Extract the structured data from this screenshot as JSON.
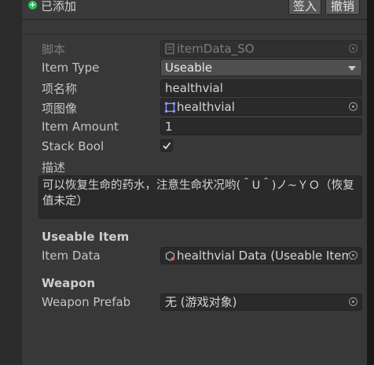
{
  "header": {
    "added_label": "已添加",
    "checkin_button": "签入",
    "revert_button": "撤销"
  },
  "fields": {
    "script_label": "脚本",
    "script_value": "itemData_SO",
    "item_type_label": "Item Type",
    "item_type_value": "Useable",
    "name_label": "项名称",
    "name_value": "healthvial",
    "image_label": "项图像",
    "image_value": "healthvial",
    "amount_label": "Item Amount",
    "amount_value": "1",
    "stack_label": "Stack Bool",
    "stack_checked": true,
    "description_label": "描述",
    "description_value": "可以恢复生命的药水，注意生命状况哟(＾U＾)ノ~ＹＯ（恢复值未定）"
  },
  "useable_item": {
    "title": "Useable Item",
    "item_data_label": "Item Data",
    "item_data_value": "healthvial Data (Useable Item"
  },
  "weapon": {
    "title": "Weapon",
    "prefab_label": "Weapon Prefab",
    "prefab_value": "无 (游戏对象)"
  },
  "icons": {
    "added": "plus-circle-icon",
    "script": "script-file-icon",
    "sprite": "sprite-icon",
    "scriptable_object": "scriptable-object-icon",
    "object_picker": "object-picker-icon",
    "dropdown": "chevron-down-icon",
    "check": "checkmark-icon"
  },
  "colors": {
    "background": "#383838",
    "field_bg": "#2a2a2a",
    "added_green": "#21c45a",
    "sprite_accent": "#5b6bff",
    "so_accent": "#e35b5b"
  }
}
